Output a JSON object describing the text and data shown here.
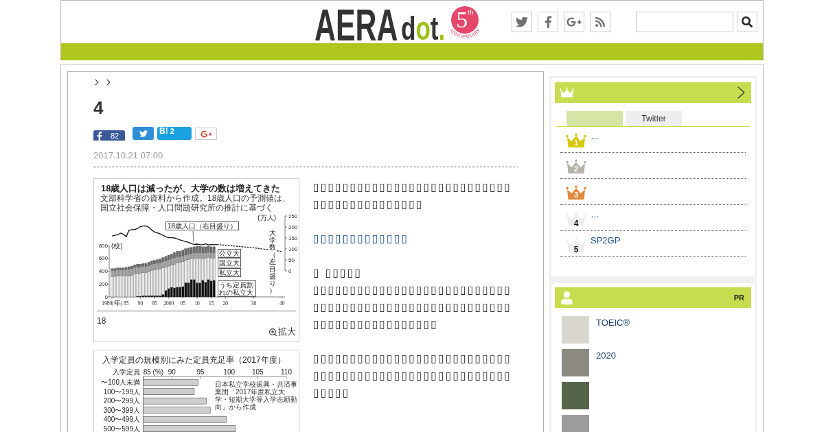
{
  "header": {
    "logo": {
      "wordmark": "AERA",
      "wordmark_suffix": "dot.",
      "badge_number": "5",
      "badge_suffix": "th",
      "badge_caption": "ANNIVERSARY"
    },
    "social_links": [
      {
        "kind": "twitter"
      },
      {
        "kind": "facebook"
      },
      {
        "kind": "googleplus"
      },
      {
        "kind": "rss"
      }
    ]
  },
  "article": {
    "title": "4",
    "share_buttons": [
      {
        "kind": "facebook",
        "count": "82"
      },
      {
        "kind": "twitter"
      },
      {
        "kind": "hatena",
        "label": "B!",
        "count": "2"
      },
      {
        "kind": "googleplus"
      }
    ],
    "date": "2017.10.21 07:00",
    "figures": [
      {
        "bar_chart": {
          "chart_data": {
            "type": "bar",
            "stacked": true,
            "title": "18歳人口は減ったが、大学の数は増えてきた",
            "ylabel": "大学数（左目盛り）",
            "x": [
              1980,
              1981,
              1982,
              1983,
              1984,
              1985,
              1986,
              1987,
              1988,
              1989,
              1990,
              1991,
              1992,
              1993,
              1994,
              1995,
              1996,
              1997,
              1998,
              1999,
              2000,
              2001,
              2002,
              2003,
              2004,
              2005,
              2006,
              2007,
              2008,
              2009,
              2010,
              2011,
              2012,
              2013,
              2014,
              2015,
              2016
            ],
            "xlim": [
              1979,
              2041
            ],
            "ylim": [
              0,
              800
            ],
            "yticks": [
              0,
              200,
              400,
              600,
              800
            ],
            "xticks": [
              {
                "value": 1980,
                "label": "1980(年)"
              },
              {
                "value": 1985,
                "label": "85"
              },
              {
                "value": 1990,
                "label": "90"
              },
              {
                "value": 1995,
                "label": "95"
              },
              2000,
              {
                "value": 2005,
                "label": "05"
              },
              {
                "value": 2010,
                "label": "10"
              },
              {
                "value": 2015,
                "label": "15"
              }
            ],
            "series": [
              {
                "name": "うち定員割れの私立大",
                "color": "#111111",
                "values": [
                  0,
                  0,
                  0,
                  0,
                  0,
                  0,
                  0,
                  0,
                  0,
                  10,
                  10,
                  20,
                  20,
                  20,
                  20,
                  20,
                  20,
                  20,
                  40,
                  100,
                  130,
                  150,
                  140,
                  150,
                  150,
                  160,
                  220,
                  220,
                  270,
                  270,
                  220,
                  220,
                  260,
                  230,
                  270,
                  250,
                  260
                ]
              },
              {
                "name": "私立大",
                "color": "#eaeaea",
                "values": [
                  320,
                  320,
                  330,
                  330,
                  330,
                  330,
                  330,
                  340,
                  360,
                  360,
                  360,
                  360,
                  360,
                  370,
                  390,
                  400,
                  410,
                  410,
                  410,
                  360,
                  350,
                  350,
                  370,
                  380,
                  390,
                  390,
                  350,
                  360,
                  320,
                  330,
                  380,
                  380,
                  340,
                  370,
                  340,
                  350,
                  340
                ]
              },
              {
                "name": "国立大",
                "color": "#a3a3a3",
                "values": [
                  90,
                  90,
                  90,
                  90,
                  90,
                  100,
                  100,
                  100,
                  100,
                  100,
                  100,
                  100,
                  100,
                  100,
                  100,
                  100,
                  100,
                  100,
                  100,
                  100,
                  100,
                  100,
                  100,
                  100,
                  90,
                  90,
                  90,
                  90,
                  90,
                  90,
                  90,
                  90,
                  90,
                  90,
                  90,
                  90,
                  90
                ]
              },
              {
                "name": "公立大",
                "color": "#6b6b6b",
                "values": [
                  30,
                  30,
                  30,
                  30,
                  30,
                  30,
                  40,
                  40,
                  40,
                  40,
                  40,
                  40,
                  40,
                  50,
                  50,
                  50,
                  50,
                  60,
                  60,
                  70,
                  70,
                  70,
                  80,
                  80,
                  80,
                  90,
                  90,
                  90,
                  90,
                  90,
                  100,
                  100,
                  90,
                  90,
                  90,
                  90,
                  90
                ]
              }
            ],
            "annotations": [
              {
                "text": "文部科学省の資料から作成。18歳人口の予測値は、国立社会保障・人口問題研究所の推計に基づく"
              },
              {
                "text": "(校)"
              }
            ]
          }
        },
        "line_chart": {
          "chart_data": {
            "type": "line",
            "ylabel": "(万人)",
            "x": [
              1980,
              1981,
              1982,
              1983,
              1984,
              1985,
              1986,
              1987,
              1988,
              1989,
              1990,
              1991,
              1992,
              1993,
              1994,
              1995,
              1996,
              1997,
              1998,
              1999,
              2000,
              2001,
              2002,
              2003,
              2004,
              2005,
              2006,
              2007,
              2008,
              2009,
              2010,
              2011,
              2012,
              2013,
              2014,
              2015,
              2016,
              2017,
              2020,
              2030,
              2040
            ],
            "xlim": [
              1979,
              2041
            ],
            "xticks": [
              {
                "value": 2020,
                "label": "20"
              },
              {
                "value": 2030,
                "label": "30"
              },
              {
                "value": 2040,
                "label": "40"
              }
            ],
            "ylim": [
              0,
              250
            ],
            "yticks": [
              0,
              50,
              100,
              150,
              200,
              250
            ],
            "series": [
              {
                "name": "18歳人口（右目盛り）",
                "color": "#111111",
                "line_style": "solid",
                "values": [
                  158,
                  162,
                  164,
                  172,
                  167,
                  156,
                  185,
                  188,
                  188,
                  193,
                  201,
                  204,
                  205,
                  198,
                  186,
                  177,
                  173,
                  168,
                  162,
                  155,
                  151,
                  151,
                  150,
                  146,
                  141,
                  137,
                  133,
                  130,
                  124,
                  121,
                  122,
                  120,
                  119,
                  123,
                  118,
                  120,
                  119,
                  120,
                  null,
                  null,
                  null
                ]
              },
              {
                "color": "#111111",
                "line_style": "dashed",
                "values": [
                  null,
                  null,
                  null,
                  null,
                  null,
                  null,
                  null,
                  null,
                  null,
                  null,
                  null,
                  null,
                  null,
                  null,
                  null,
                  null,
                  null,
                  null,
                  null,
                  null,
                  null,
                  null,
                  null,
                  null,
                  null,
                  null,
                  null,
                  null,
                  null,
                  null,
                  null,
                  null,
                  null,
                  null,
                  null,
                  null,
                  null,
                  120,
                  117,
                  105,
                  88
                ]
              }
            ]
          }
        },
        "caption": "18",
        "zoom_label": "拡大"
      },
      {
        "chart_data": {
          "type": "bar",
          "orientation": "horizontal",
          "title": "入学定員の規模別にみた定員充足率（2017年度）",
          "ylabel": "入学定員",
          "categories": [
            "〜100人未満",
            "100〜199人",
            "200〜299人",
            "300〜399人",
            "400〜499人",
            "500〜599人"
          ],
          "values": [
            94.6,
            93.9,
            96.0,
            96.7,
            99.5,
            101.1
          ],
          "xlim": [
            85,
            110
          ],
          "xticks": [
            {
              "value": 85,
              "label": "85 (%)"
            },
            90,
            95,
            100,
            105,
            110
          ],
          "annotations": [
            {
              "text": "日本私立学校振興・共済事業団「2017年度私立大学・短期大学等入学志願動向」から作成"
            }
          ]
        }
      }
    ],
    "body": [
      {
        "kind": "paragraph",
        "text": "▯▯▯▯▯▯▯▯▯▯▯▯▯▯▯▯▯▯▯▯▯▯▯▯▯▯▯▯▯▯▯▯▯▯▯▯▯▯▯▯▯▯"
      },
      {
        "kind": "link",
        "text": "▯▯▯▯▯▯▯▯▯▯▯▯▯"
      },
      {
        "kind": "byline",
        "text": "▯ ▯▯▯▯▯"
      },
      {
        "kind": "paragraph",
        "text": "▯▯▯▯▯▯▯▯▯▯▯▯▯▯▯▯▯▯▯▯▯▯▯▯▯▯▯▯▯▯▯▯▯▯▯▯▯▯▯▯▯▯▯▯▯▯▯▯▯▯▯▯▯▯▯▯▯▯▯▯▯▯▯▯▯▯▯▯▯▯▯"
      },
      {
        "kind": "paragraph",
        "text": "▯▯▯▯▯▯▯▯▯▯▯▯▯▯▯▯▯▯▯▯▯▯▯▯▯▯▯▯▯▯▯▯▯▯▯▯▯▯▯▯▯▯▯▯▯▯▯▯▯▯▯▯▯▯▯▯▯▯▯"
      }
    ]
  },
  "sidebar": {
    "ranking": {
      "tabs": [
        {
          "selected": true
        },
        {
          "label": "Twitter",
          "selected": false
        }
      ],
      "items": [
        {
          "rank": "1",
          "kind": "medal",
          "color": "#d8c700",
          "title": "…"
        },
        {
          "rank": "2",
          "kind": "medal",
          "color": "#b3b3ab"
        },
        {
          "rank": "3",
          "kind": "medal",
          "color": "#e28a3d"
        },
        {
          "rank": "4",
          "kind": "plain",
          "color": "#ededed",
          "title": "…"
        },
        {
          "rank": "5",
          "kind": "plain",
          "color": "#ededed",
          "title": "SP2GP"
        }
      ]
    },
    "pr": {
      "label": "PR",
      "items": [
        {
          "photo": true,
          "title": "TOEIC®"
        },
        {
          "photo": true,
          "title": "2020"
        },
        {
          "photo": true
        },
        {
          "photo": true
        }
      ]
    }
  }
}
